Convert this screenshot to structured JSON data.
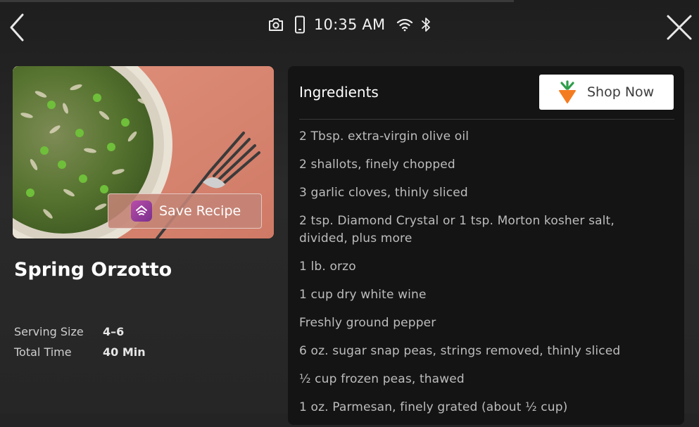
{
  "status_bar": {
    "time": "10:35 AM",
    "icons": [
      "camera-icon",
      "phone-icon",
      "wifi-icon",
      "bluetooth-icon"
    ]
  },
  "navigation": {
    "back_icon": "chevron-left-icon",
    "close_icon": "close-icon"
  },
  "recipe": {
    "title": "Spring Orzotto",
    "image": "bowl of spring orzotto with peas and a fork on a pink cloth",
    "save_button": "Save Recipe",
    "serving_size_label": "Serving Size",
    "serving_size_value": "4–6",
    "total_time_label": "Total Time",
    "total_time_value": "40 Min"
  },
  "ingredients_panel": {
    "title": "Ingredients",
    "shop_button": "Shop Now",
    "items": [
      "2 Tbsp. extra-virgin olive oil",
      "2 shallots, finely chopped",
      "3 garlic cloves, thinly sliced",
      "2 tsp. Diamond Crystal or 1 tsp. Morton kosher salt, divided, plus more",
      "1 lb. orzo",
      "1 cup dry white wine",
      "Freshly ground pepper",
      "6 oz. sugar snap peas, strings removed, thinly sliced",
      "½ cup frozen peas, thawed",
      "1 oz. Parmesan, finely grated (about ½ cup)"
    ]
  },
  "colors": {
    "background": "#242424",
    "panel": "#141414",
    "shop_button_bg": "#ffffff",
    "save_button_bg": "#c48476",
    "app_icon": "#9a3fa0",
    "carrot_orange": "#f47c20",
    "carrot_green": "#2e9e4a"
  }
}
